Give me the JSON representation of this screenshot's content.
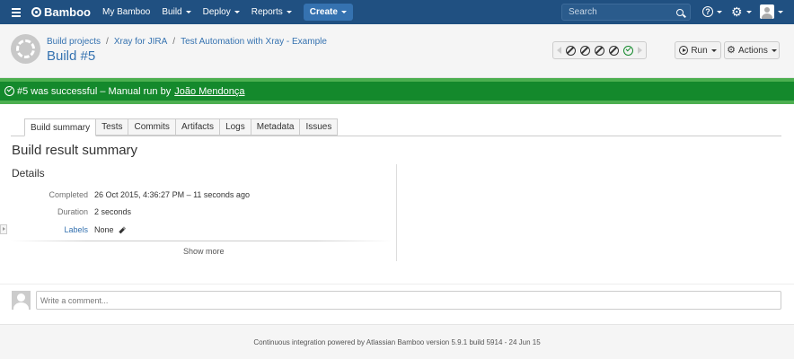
{
  "topnav": {
    "brand": "Bamboo",
    "items": [
      {
        "label": "My Bamboo",
        "dropdown": false
      },
      {
        "label": "Build",
        "dropdown": true
      },
      {
        "label": "Deploy",
        "dropdown": true
      },
      {
        "label": "Reports",
        "dropdown": true
      }
    ],
    "create_label": "Create",
    "search_placeholder": "Search",
    "help_glyph": "?",
    "gear_glyph": "⚙"
  },
  "header": {
    "breadcrumbs": [
      "Build projects",
      "Xray for JIRA",
      "Test Automation with Xray - Example"
    ],
    "separator": "/",
    "title": "Build #5",
    "run_label": "Run",
    "actions_label": "Actions",
    "history": [
      "na",
      "na",
      "na",
      "na",
      "ok"
    ]
  },
  "status": {
    "text": "#5 was successful – Manual run by",
    "user": "João Mendonça"
  },
  "tabs": [
    {
      "label": "Build summary",
      "active": true
    },
    {
      "label": "Tests",
      "active": false
    },
    {
      "label": "Commits",
      "active": false
    },
    {
      "label": "Artifacts",
      "active": false
    },
    {
      "label": "Logs",
      "active": false
    },
    {
      "label": "Metadata",
      "active": false
    },
    {
      "label": "Issues",
      "active": false
    }
  ],
  "summary": {
    "title": "Build result summary",
    "details_title": "Details",
    "completed_label": "Completed",
    "completed_value": "26 Oct 2015, 4:36:27 PM – 11 seconds ago",
    "duration_label": "Duration",
    "duration_value": "2 seconds",
    "labels_label": "Labels",
    "labels_value": "None",
    "show_more": "Show more"
  },
  "comment": {
    "placeholder": "Write a comment..."
  },
  "footer": {
    "text": "Continuous integration powered by Atlassian Bamboo version 5.9.1 build 5914 - 24 Jun 15"
  },
  "colors": {
    "nav_bg": "#205081",
    "link": "#3572b0",
    "success": "#14892c"
  }
}
